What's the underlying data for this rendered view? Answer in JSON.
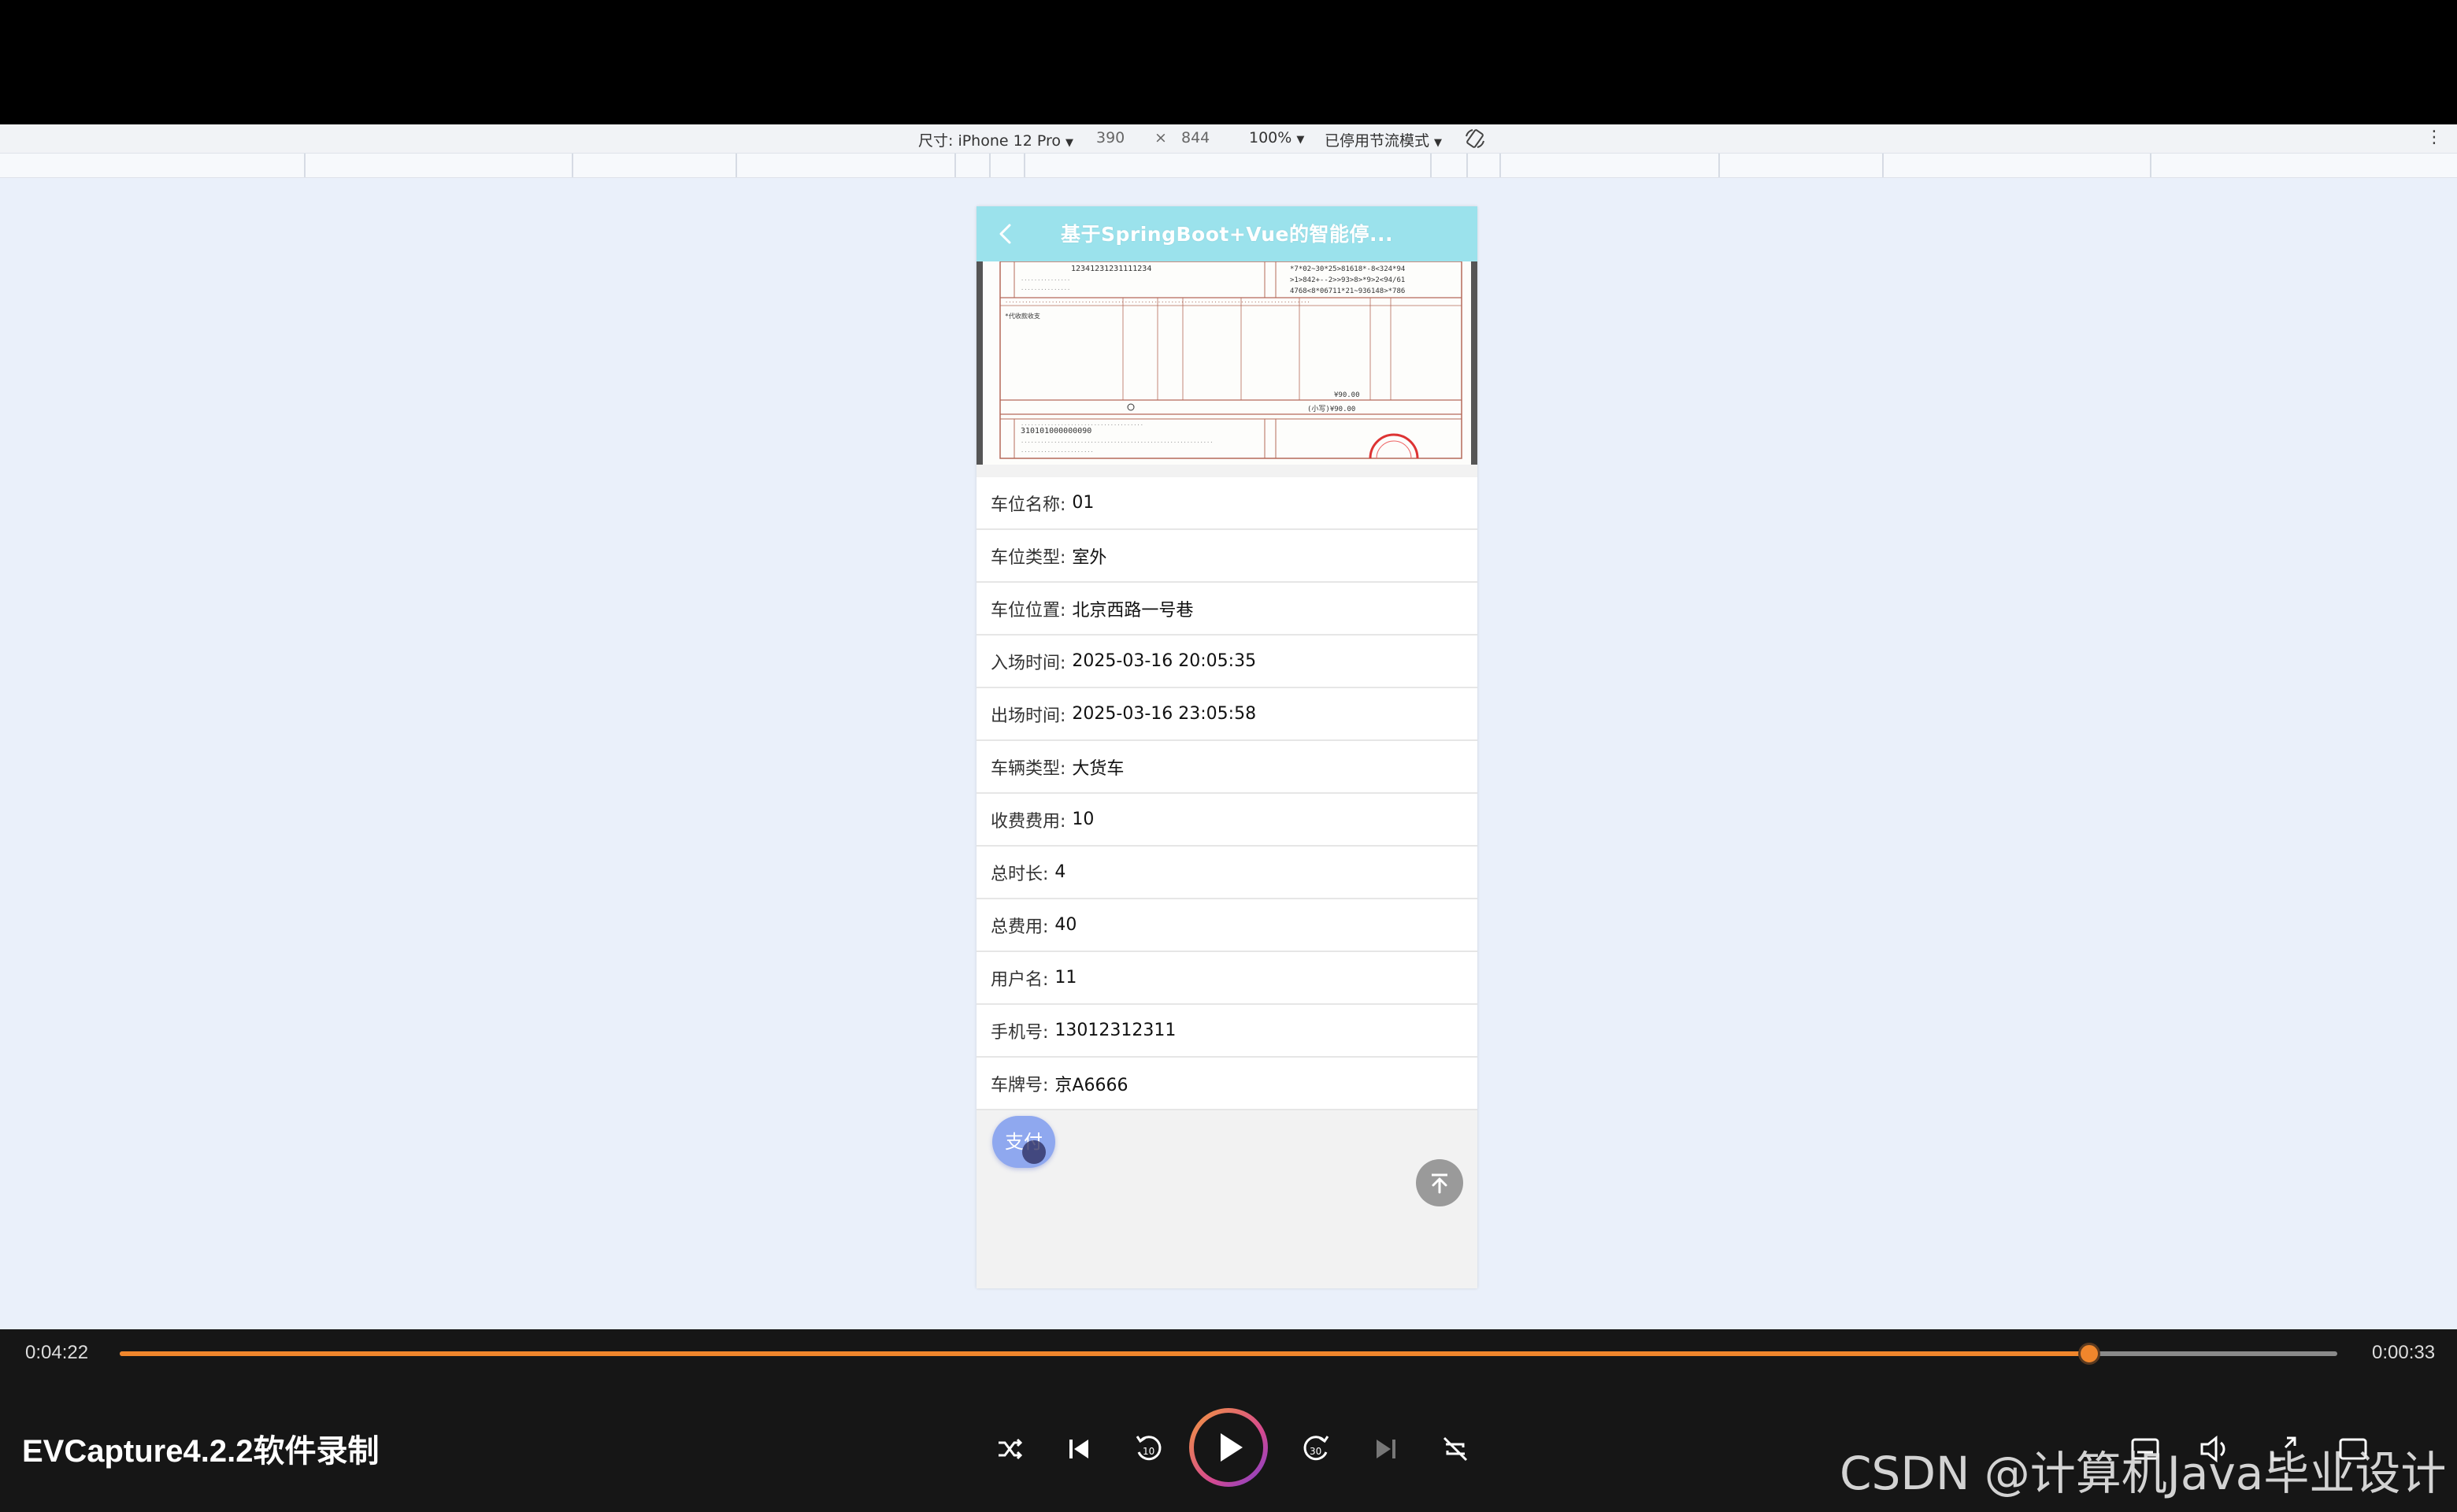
{
  "device_toolbar": {
    "dimensions_label": "尺寸: iPhone 12 Pro",
    "width": "390",
    "times": "×",
    "height": "844",
    "zoom": "100%",
    "throttle": "已停用节流模式"
  },
  "app": {
    "title": "基于SpringBoot+Vue的智能停...",
    "invoice_text": {
      "buyer_id": "12341231231111234",
      "code_line_1": "*7*02~30*25>81618*-8<324*94",
      "code_line_2": ">1>842+--2>>93>8>*9>2<94/61",
      "code_line_3": "4768<8*06711*21~936148>*786",
      "item_name": "*代收款收支",
      "amount_1": "¥90.00",
      "amount_2": "(小写)¥90.00",
      "seller_tax_id": "310101000000090"
    },
    "fields": [
      {
        "label": "车位名称:",
        "value": "01"
      },
      {
        "label": "车位类型:",
        "value": "室外"
      },
      {
        "label": "车位位置:",
        "value": "北京西路一号巷"
      },
      {
        "label": "入场时间:",
        "value": "2025-03-16 20:05:35"
      },
      {
        "label": "出场时间:",
        "value": "2025-03-16 23:05:58"
      },
      {
        "label": "车辆类型:",
        "value": "大货车"
      },
      {
        "label": "收费费用:",
        "value": "10"
      },
      {
        "label": "总时长:",
        "value": "4"
      },
      {
        "label": "总费用:",
        "value": "40"
      },
      {
        "label": "用户名:",
        "value": "11"
      },
      {
        "label": "手机号:",
        "value": "13012312311"
      },
      {
        "label": "车牌号:",
        "value": "京A6666"
      }
    ],
    "pay_button": "支付"
  },
  "player": {
    "current_time": "0:04:22",
    "remaining_time": "0:00:33",
    "progress_fraction": 0.888,
    "brand": "EVCapture4.2.2软件录制",
    "watermark": "CSDN @计算机Java毕业设计",
    "accent_color": "#f0862c"
  }
}
